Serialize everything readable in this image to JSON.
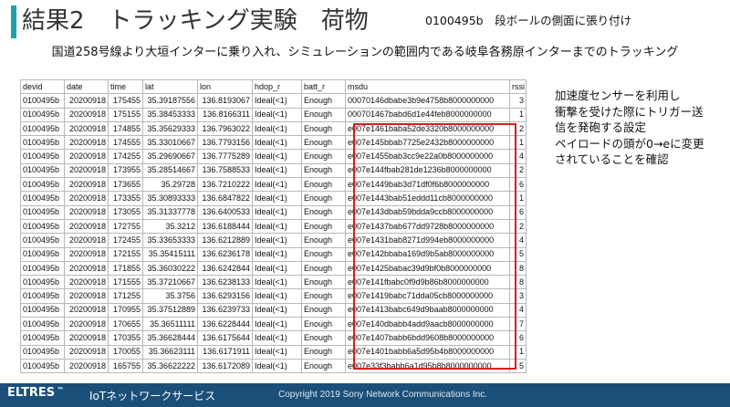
{
  "header": {
    "title": "結果2　トラッキング実験　荷物",
    "note": "0100495b　段ボールの側面に張り付け"
  },
  "subtitle": "国道258号線より大垣インターに乗り入れ、シミュレーションの範囲内である岐阜各務原インターまでのトラッキング",
  "table": {
    "columns": [
      "devid",
      "date",
      "time",
      "lat",
      "lon",
      "hdop_r",
      "batt_r",
      "msdu",
      "rssi"
    ],
    "rows": [
      [
        "0100495b",
        "20200918",
        "175455",
        "35.39187556",
        "136.8193067",
        "Ideal(<1)",
        "Enough",
        "00070146dbabe3b9e4758b8000000000",
        "3"
      ],
      [
        "0100495b",
        "20200918",
        "175155",
        "35.38453333",
        "136.8166311",
        "Ideal(<1)",
        "Enough",
        "000701467babd6d1e44feb8000000000",
        "1"
      ],
      [
        "0100495b",
        "20200918",
        "174855",
        "35.35629333",
        "136.7963022",
        "Ideal(<1)",
        "Enough",
        "e007e1461baba52de3320b8000000000",
        "2"
      ],
      [
        "0100495b",
        "20200918",
        "174555",
        "35.33010667",
        "136.7793156",
        "Ideal(<1)",
        "Enough",
        "e007e145bbab7725e2432b8000000000",
        "1"
      ],
      [
        "0100495b",
        "20200918",
        "174255",
        "35.29690667",
        "136.7775289",
        "Ideal(<1)",
        "Enough",
        "e007e1455bab3cc9e22a0b8000000000",
        "4"
      ],
      [
        "0100495b",
        "20200918",
        "173955",
        "35.28514667",
        "136.7588533",
        "Ideal(<1)",
        "Enough",
        "e007e144fbab281de1236b8000000000",
        "2"
      ],
      [
        "0100495b",
        "20200918",
        "173655",
        "35.29728",
        "136.7210222",
        "Ideal(<1)",
        "Enough",
        "e007e1449bab3d71df0f6b8000000000",
        "6"
      ],
      [
        "0100495b",
        "20200918",
        "173355",
        "35.30893333",
        "136.6847822",
        "Ideal(<1)",
        "Enough",
        "e007e1443bab51eddd11cb8000000000",
        "1"
      ],
      [
        "0100495b",
        "20200918",
        "173055",
        "35.31337778",
        "136.6400533",
        "Ideal(<1)",
        "Enough",
        "e007e143dbab59bdda9ccb8000000000",
        "6"
      ],
      [
        "0100495b",
        "20200918",
        "172755",
        "35.3212",
        "136.6188444",
        "Ideal(<1)",
        "Enough",
        "e007e1437bab677dd9728b8000000000",
        "2"
      ],
      [
        "0100495b",
        "20200918",
        "172455",
        "35.33653333",
        "136.6212889",
        "Ideal(<1)",
        "Enough",
        "e007e1431bab8271d994eb8000000000",
        "4"
      ],
      [
        "0100495b",
        "20200918",
        "172155",
        "35.35415111",
        "136.6236178",
        "Ideal(<1)",
        "Enough",
        "e007e142bbaba169d9b5ab8000000000",
        "5"
      ],
      [
        "0100495b",
        "20200918",
        "171855",
        "35.36030222",
        "136.6242844",
        "Ideal(<1)",
        "Enough",
        "e007e1425babac39d9bf0b8000000000",
        "8"
      ],
      [
        "0100495b",
        "20200918",
        "171555",
        "35.37210667",
        "136.6238133",
        "Ideal(<1)",
        "Enough",
        "e007e141fbabc0f9d9b86b8000000000",
        "8"
      ],
      [
        "0100495b",
        "20200918",
        "171255",
        "35.3756",
        "136.6293156",
        "Ideal(<1)",
        "Enough",
        "e007e1419babc71dda05cb8000000000",
        "3"
      ],
      [
        "0100495b",
        "20200918",
        "170955",
        "35.37512889",
        "136.6239733",
        "Ideal(<1)",
        "Enough",
        "e007e1413babc649d9baab8000000000",
        "4"
      ],
      [
        "0100495b",
        "20200918",
        "170655",
        "35.36511111",
        "136.6228444",
        "Ideal(<1)",
        "Enough",
        "e007e140dbabb4add9aacb8000000000",
        "7"
      ],
      [
        "0100495b",
        "20200918",
        "170355",
        "35.36628444",
        "136.6175644",
        "Ideal(<1)",
        "Enough",
        "e007e1407babb6bdd9608b8000000000",
        "6"
      ],
      [
        "0100495b",
        "20200918",
        "170055",
        "35.36623111",
        "136.6171911",
        "Ideal(<1)",
        "Enough",
        "e007e1401babb6a5d95b4b8000000000",
        "1"
      ],
      [
        "0100495b",
        "20200918",
        "165755",
        "35.36622222",
        "136.6172089",
        "Ideal(<1)",
        "Enough",
        "e007e33f3babb6a1d95b8b8000000000",
        "5"
      ]
    ]
  },
  "callout": {
    "lines": [
      "加速度センサーを利用し",
      "衝撃を受けた際にトリガー送",
      "信を発砲する設定",
      "ペイロードの頭が0→eに変更",
      "されていることを確認"
    ]
  },
  "footer": {
    "brand": "ELTRES",
    "trademark": "™",
    "service": "IoTネットワークサービス",
    "copyright": "Copyright 2019 Sony Network Communications Inc."
  },
  "colors": {
    "accent": "#19a3a8",
    "highlight": "#d81e1e",
    "footer": "#1a4f7a"
  }
}
